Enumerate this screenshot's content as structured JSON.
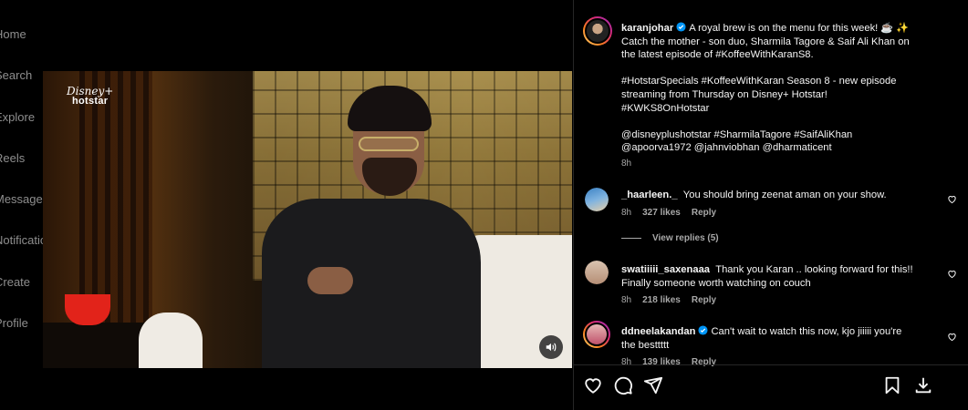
{
  "nav": {
    "items": [
      "Home",
      "Search",
      "Explore",
      "Reels",
      "Messages",
      "Notifications",
      "Create",
      "Profile"
    ]
  },
  "video": {
    "logo_top": "Disney+",
    "logo_bottom": "hotstar",
    "mute_icon": "volume-icon"
  },
  "post": {
    "username": "karanjohar",
    "caption_lines": [
      "A royal brew is on the menu for this week! ☕ ✨",
      "Catch the mother - son duo, Sharmila Tagore & Saif Ali Khan on",
      "the latest episode of #KoffeeWithKaranS8.",
      "",
      "#HotstarSpecials #KoffeeWithKaran Season 8 - new episode",
      "streaming from Thursday on Disney+ Hotstar!",
      "#KWKS8OnHotstar",
      "",
      "@disneyplushotstar #SharmilaTagore #SaifAliKhan",
      "@apoorva1972 @jahnviobhan @dharmaticent"
    ],
    "time": "8h"
  },
  "comments": [
    {
      "username": "_haarleen._",
      "text": "You should bring zeenat aman on your show.",
      "time": "8h",
      "likes": "327 likes",
      "reply": "Reply",
      "view_replies": "View replies (5)",
      "verified": false
    },
    {
      "username": "swatiiiii_saxenaaa",
      "text_lines": [
        "Thank you Karan .. looking forward for this!!",
        "Finally someone worth watching on couch"
      ],
      "time": "8h",
      "likes": "218 likes",
      "reply": "Reply",
      "verified": false
    },
    {
      "username": "ddneelakandan",
      "text_lines": [
        "Can't wait to watch this now, kjo jiiiii you're",
        "the besttttt"
      ],
      "time": "8h",
      "likes": "139 likes",
      "reply": "Reply",
      "verified": true
    }
  ],
  "actions": {
    "like_icon": "heart-icon",
    "comment_icon": "comment-icon",
    "share_icon": "share-icon",
    "save_icon": "bookmark-icon",
    "download_icon": "download-icon"
  },
  "colors": {
    "background": "#000000",
    "text": "#f5f5f5",
    "muted": "#a8a8a8",
    "verified": "#0095f6",
    "divider": "#262626"
  }
}
